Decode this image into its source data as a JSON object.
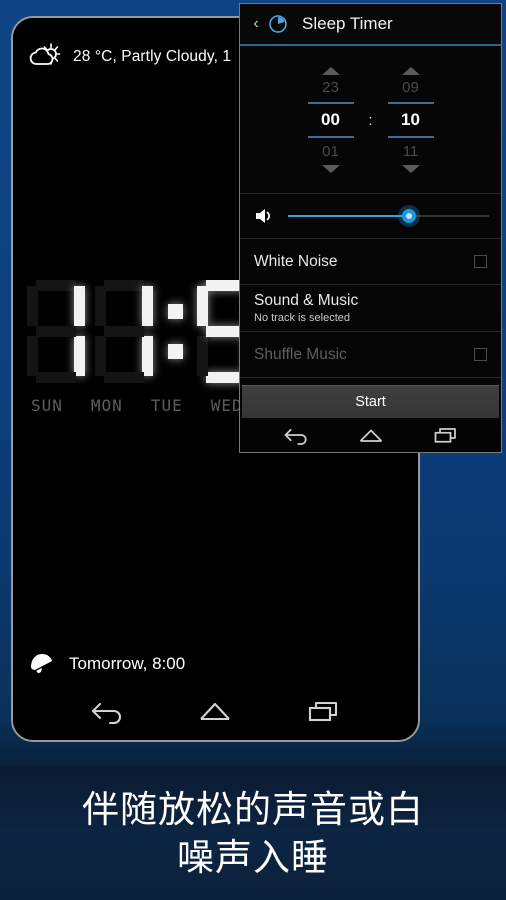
{
  "background": {
    "blue_top": "#0e4485",
    "blue_bottom": "#0b2038",
    "caption_band": "#0d2544"
  },
  "phone": {
    "weather": {
      "icon": "partly-cloudy-icon",
      "text": "28 °C, Partly Cloudy, 1"
    },
    "clock": {
      "digits": "11:5",
      "hour": "11",
      "minute_partial": "5",
      "days": [
        "SUN",
        "MON",
        "TUE",
        "WED"
      ]
    },
    "alarm": {
      "icon": "alarm-bell-icon",
      "text": "Tomorrow, 8:00"
    },
    "navbar": {
      "back": "back-icon",
      "home": "home-icon",
      "recents": "recents-icon"
    }
  },
  "dialog": {
    "back_chevron": "‹",
    "title_icon": "timer-clock-icon",
    "title": "Sleep Timer",
    "picker": {
      "hours": {
        "prev": "23",
        "value": "00",
        "next": "01"
      },
      "separator": ":",
      "minutes": {
        "prev": "09",
        "value": "10",
        "next": "11"
      },
      "up_arrow": "chevron-up-icon",
      "down_arrow": "chevron-down-icon"
    },
    "volume": {
      "icon": "speaker-icon",
      "level_percent": 60,
      "accent": "#2196dd"
    },
    "rows": [
      {
        "title": "White Noise",
        "subtitle": "",
        "checkbox": true,
        "checked": false,
        "enabled": true
      },
      {
        "title": "Sound & Music",
        "subtitle": "No track is selected",
        "checkbox": false,
        "checked": false,
        "enabled": true
      },
      {
        "title": "Shuffle Music",
        "subtitle": "",
        "checkbox": true,
        "checked": false,
        "enabled": false
      }
    ],
    "start_button": "Start",
    "navbar": {
      "back": "back-icon",
      "home": "home-icon",
      "recents": "recents-icon"
    }
  },
  "caption": {
    "line1": "伴随放松的声音或白",
    "line2": "噪声入睡"
  }
}
